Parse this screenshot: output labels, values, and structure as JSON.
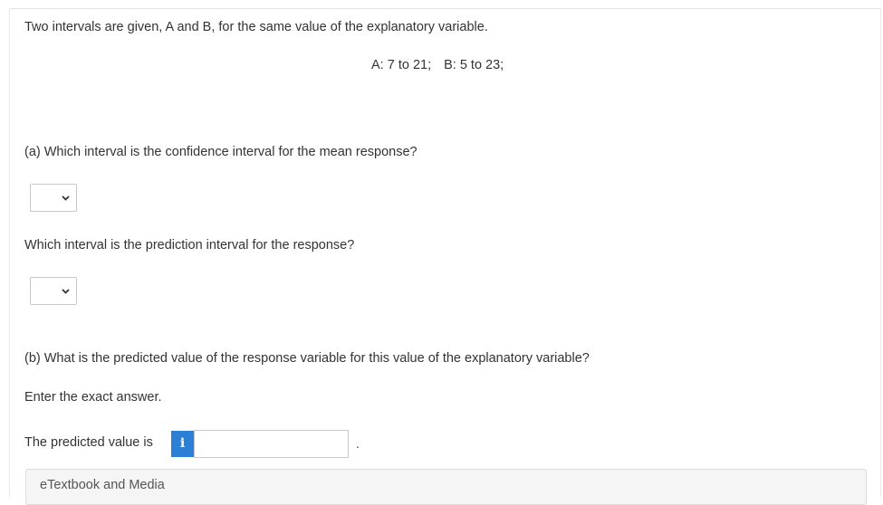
{
  "question": {
    "intro": "Two intervals are given, A and B, for the same value of the explanatory variable.",
    "interval_a": "A: 7 to 21;",
    "interval_b": "B: 5 to 23;",
    "part_a_label": "(a) Which interval is the confidence interval for the mean response?",
    "part_a_followup": "Which interval is the prediction interval for the response?",
    "part_b_label": "(b) What is the predicted value of the response variable for this value of the explanatory variable?",
    "exact_note": "Enter the exact answer.",
    "predicted_label": "The predicted value is",
    "info_glyph": "i",
    "period": "."
  },
  "dropdowns": {
    "confidence_selected": "",
    "prediction_selected": ""
  },
  "answer_value": "",
  "resources": {
    "label": "eTextbook and Media"
  },
  "colors": {
    "info_button": "#2b7fd5",
    "text": "#333333"
  },
  "icons": {
    "dropdown": "chevron-down-icon",
    "info": "info-icon"
  }
}
